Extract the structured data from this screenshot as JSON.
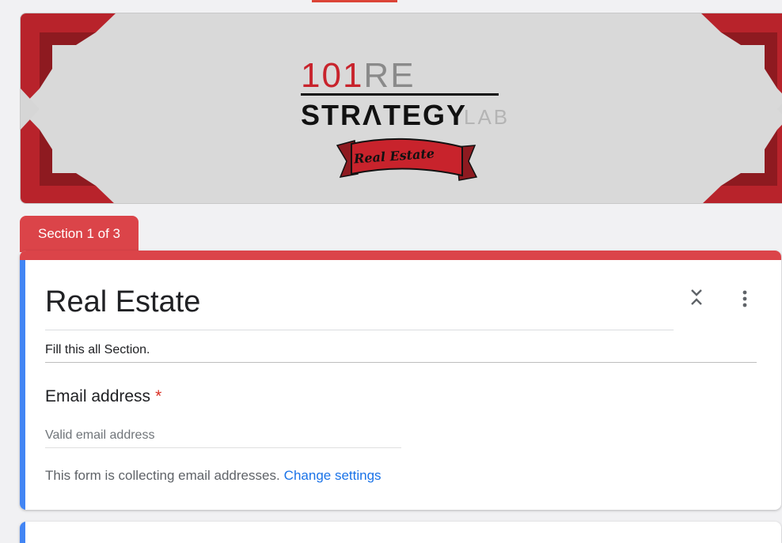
{
  "banner": {
    "logo_number": "101",
    "logo_re": "RE",
    "logo_strategy": "STRɅTEGY",
    "logo_lab": "LAB",
    "ribbon_text": "Real Estate"
  },
  "section": {
    "tab_label": "Section 1 of 3"
  },
  "form": {
    "title": "Real Estate",
    "description": "Fill this all Section.",
    "question_label": "Email address",
    "required_mark": "*",
    "email_placeholder": "Valid email address",
    "notice_text": "This form is collecting email addresses.",
    "change_settings_label": "Change settings"
  },
  "colors": {
    "theme_red": "#db4449",
    "active_blue": "#4285f4",
    "link_blue": "#1a73e8"
  },
  "icons": {
    "collapse": "collapse-icon",
    "more": "more-vert-icon"
  }
}
